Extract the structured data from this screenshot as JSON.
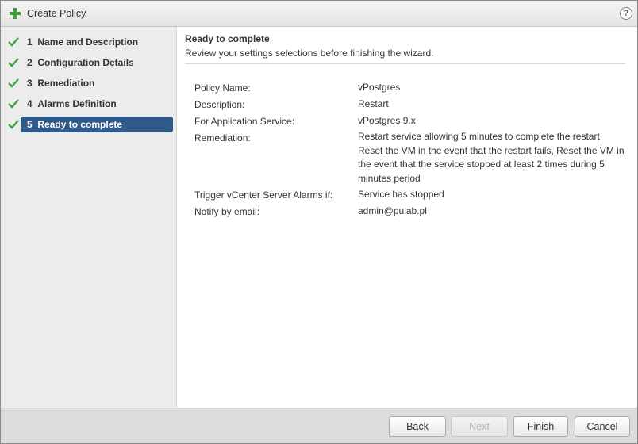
{
  "window": {
    "title": "Create Policy",
    "help": "?"
  },
  "steps": [
    {
      "num": "1",
      "label": "Name and Description",
      "state": "done"
    },
    {
      "num": "2",
      "label": "Configuration Details",
      "state": "done"
    },
    {
      "num": "3",
      "label": "Remediation",
      "state": "done"
    },
    {
      "num": "4",
      "label": "Alarms Definition",
      "state": "done"
    },
    {
      "num": "5",
      "label": "Ready to complete",
      "state": "active"
    }
  ],
  "main": {
    "title": "Ready to complete",
    "subtitle": "Review your settings selections before finishing the wizard.",
    "fields": [
      {
        "label": "Policy Name:",
        "value": "vPostgres"
      },
      {
        "label": "Description:",
        "value": "Restart"
      },
      {
        "label": "For Application Service:",
        "value": "vPostgres 9.x"
      },
      {
        "label": "Remediation:",
        "value": "Restart service allowing 5 minutes to complete the restart, Reset the VM in the event that the restart fails, Reset the VM in the event that the service stopped at least 2 times during 5 minutes period"
      },
      {
        "label": "Trigger vCenter Server Alarms if:",
        "value": "Service has stopped"
      },
      {
        "label": "Notify by email:",
        "value": "admin@pulab.pl"
      }
    ]
  },
  "footer": {
    "back": "Back",
    "next": "Next",
    "finish": "Finish",
    "cancel": "Cancel"
  },
  "colors": {
    "active_step": "#2f5a8a",
    "check": "#3aa13a",
    "add_icon": "#3aa13a"
  }
}
